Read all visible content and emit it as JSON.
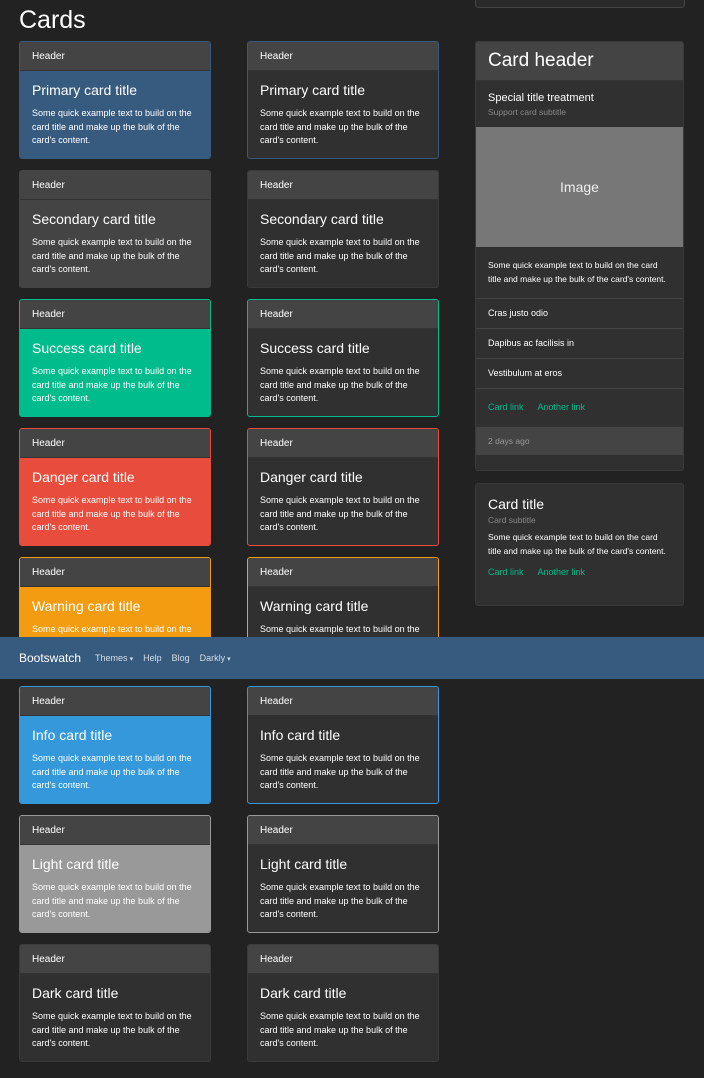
{
  "page": {
    "title": "Cards"
  },
  "text": {
    "header": "Header",
    "body": "Some quick example text to build on the card title and make up the bulk of the card's content."
  },
  "cards": [
    {
      "key": "primary",
      "title": "Primary card title",
      "color": "#375a7f"
    },
    {
      "key": "secondary",
      "title": "Secondary card title",
      "color": "#444444"
    },
    {
      "key": "success",
      "title": "Success card title",
      "color": "#00bc8c"
    },
    {
      "key": "danger",
      "title": "Danger card title",
      "color": "#e74c3c"
    },
    {
      "key": "warning",
      "title": "Warning card title",
      "color": "#f39c12"
    },
    {
      "key": "info",
      "title": "Info card title",
      "color": "#3498db"
    },
    {
      "key": "light",
      "title": "Light card title",
      "color": "#999999"
    },
    {
      "key": "dark",
      "title": "Dark card title",
      "color": "#303030"
    }
  ],
  "side_card": {
    "header": "Card header",
    "title": "Special title treatment",
    "subtitle": "Support card subtitle",
    "image_label": "Image",
    "text": "Some quick example text to build on the card title and make up the bulk of the card's content.",
    "list": [
      "Cras justo odio",
      "Dapibus ac facilisis in",
      "Vestibulum at eros"
    ],
    "link1": "Card link",
    "link2": "Another link",
    "footer": "2 days ago"
  },
  "card2": {
    "title": "Card title",
    "subtitle": "Card subtitle",
    "text": "Some quick example text to build on the card title and make up the bulk of the card's content.",
    "link1": "Card link",
    "link2": "Another link"
  },
  "navbar": {
    "brand": "Bootswatch",
    "items": [
      "Themes",
      "Help",
      "Blog",
      "Darkly"
    ],
    "caret": "▾"
  }
}
